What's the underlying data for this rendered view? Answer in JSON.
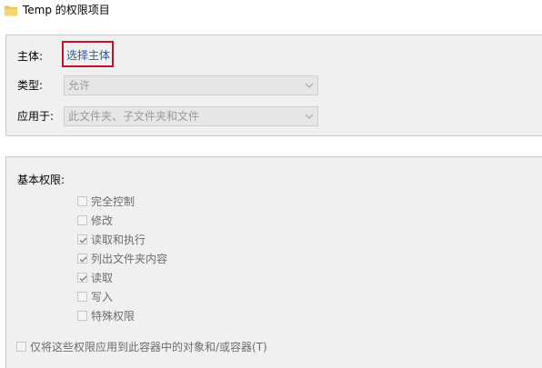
{
  "window": {
    "title": "Temp 的权限项目",
    "icon": "folder-icon"
  },
  "top_section": {
    "principal_label": "主体:",
    "principal_link": "选择主体",
    "type_label": "类型:",
    "type_value": "允许",
    "applies_label": "应用于:",
    "applies_value": "此文件夹、子文件夹和文件"
  },
  "permissions": {
    "heading": "基本权限:",
    "items": [
      {
        "label": "完全控制",
        "checked": false
      },
      {
        "label": "修改",
        "checked": false
      },
      {
        "label": "读取和执行",
        "checked": true
      },
      {
        "label": "列出文件夹内容",
        "checked": true
      },
      {
        "label": "读取",
        "checked": true
      },
      {
        "label": "写入",
        "checked": false
      },
      {
        "label": "特殊权限",
        "checked": false
      }
    ]
  },
  "inherit_option": {
    "label": "仅将这些权限应用到此容器中的对象和/或容器(T)",
    "checked": false
  },
  "colors": {
    "highlight_border": "#c8102e",
    "link": "#1a5fb4",
    "panel_bg": "#f0f0f0",
    "disabled_text": "#6d6d6d",
    "folder": "#f2c14e"
  }
}
